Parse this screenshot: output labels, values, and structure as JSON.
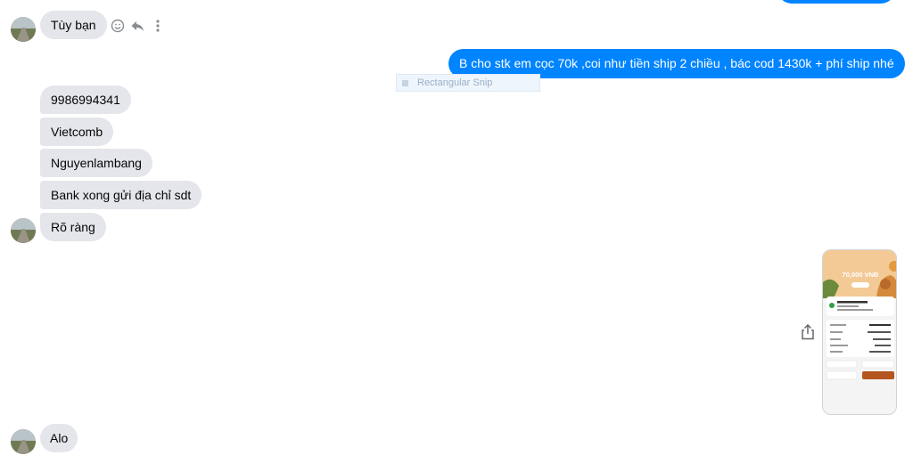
{
  "messages": {
    "incoming_1": "Tùy bạn",
    "outgoing_1": "B cho stk em cọc 70k ,coi như tiền ship 2 chiều , bác cod 1430k + phí ship nhé",
    "incoming_group": [
      "9986994341",
      "Vietcomb",
      "Nguyenlambang",
      "Bank xong gửi địa chỉ  sdt",
      "Rõ ràng"
    ],
    "incoming_last": "Alo"
  },
  "snip_overlay": {
    "label": "Rectangular Snip"
  },
  "payment_receipt": {
    "amount": "70,000 VNĐ"
  },
  "icons": [
    "avatar",
    "emoji-icon",
    "reply-icon",
    "more-icon",
    "share-icon"
  ],
  "colors": {
    "outgoing_bubble": "#0084ff",
    "incoming_bubble": "#e4e6eb",
    "receipt_accent": "#e49a3c"
  }
}
